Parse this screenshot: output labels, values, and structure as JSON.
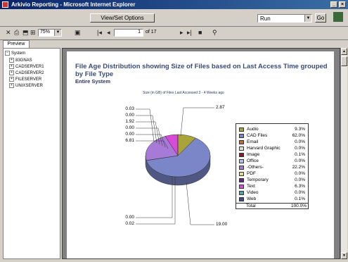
{
  "window": {
    "title": "Arkivio Reporting - Microsoft Internet Explorer",
    "controls": [
      "_",
      "×"
    ]
  },
  "toolbar": {
    "view_set_options": "View/Set Options",
    "run_select_value": "Run",
    "go_label": "Go",
    "zoom_value": "75%",
    "page_current": "1",
    "page_total_label": "of 17"
  },
  "tabs": {
    "preview": "Preview"
  },
  "tree": {
    "root": "System",
    "items": [
      "83GNAS",
      "CADSERVER1",
      "CADSERVER2",
      "FILESERVER",
      "UNIXSERVER"
    ]
  },
  "report": {
    "title": "File Age Distribution showing Size of Files based on Last Access Time grouped by File Type",
    "subtitle": "Entire System",
    "chart_title": "Size (in GB) of Files Last Accessed 3 - 4 Weeks ago"
  },
  "chart_data": {
    "type": "pie",
    "title": "Size (in GB) of Files Last Accessed 3 - 4 Weeks ago",
    "slices": [
      {
        "name": "Audio",
        "percent": "9.3%",
        "value": 2.87,
        "color": "#a9a43a"
      },
      {
        "name": "CAD Files",
        "percent": "62.0%",
        "value": 19.0,
        "color": "#7b86c8"
      },
      {
        "name": "Email",
        "percent": "0.0%",
        "value": 0.0,
        "color": "#c76a2a"
      },
      {
        "name": "Harvard Graphic",
        "percent": "0.0%",
        "value": 0.0,
        "color": "#e0e0d0"
      },
      {
        "name": "Image",
        "percent": "0.1%",
        "value": 0.02,
        "color": "#8a1a2a"
      },
      {
        "name": "Office",
        "percent": "0.0%",
        "value": 0.0,
        "color": "#a8c4e8"
      },
      {
        "name": "-Others-",
        "percent": "22.2%",
        "value": 6.81,
        "color": "#a77ad8"
      },
      {
        "name": "PDF",
        "percent": "0.0%",
        "value": 0.0,
        "color": "#e8d888"
      },
      {
        "name": "Temporary",
        "percent": "0.0%",
        "value": 0.0,
        "color": "#5a2a8a"
      },
      {
        "name": "Text",
        "percent": "6.3%",
        "value": 1.92,
        "color": "#d84ad8"
      },
      {
        "name": "Video",
        "percent": "0.0%",
        "value": 0.0,
        "color": "#4aa8a8"
      },
      {
        "name": "Web",
        "percent": "0.1%",
        "value": 0.0,
        "color": "#3a4a8a"
      }
    ],
    "total_label": "Total",
    "total_percent": "100.0%",
    "left_labels": [
      "0.03",
      "0.00",
      "1.92",
      "0.00",
      "0.00",
      "6.81"
    ],
    "bottom_labels": [
      "0.00",
      "0.02"
    ],
    "right_labels": [
      "2.87",
      "19.00"
    ]
  }
}
